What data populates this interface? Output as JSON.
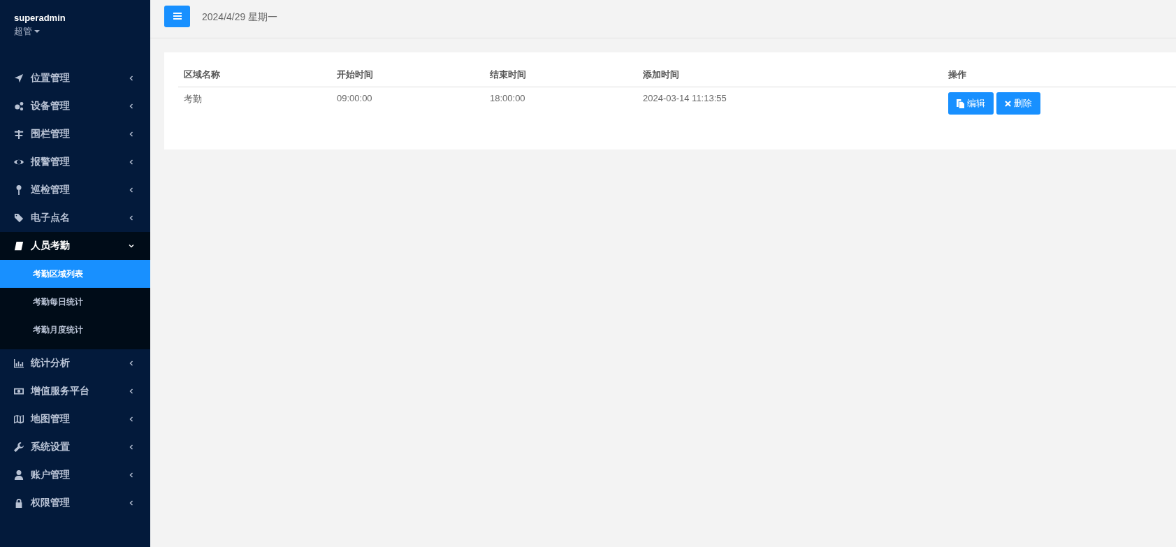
{
  "user": {
    "name": "superadmin",
    "role": "超管"
  },
  "menu": [
    {
      "label": "位置管理",
      "expanded": false
    },
    {
      "label": "设备管理",
      "expanded": false
    },
    {
      "label": "围栏管理",
      "expanded": false
    },
    {
      "label": "报警管理",
      "expanded": false
    },
    {
      "label": "巡检管理",
      "expanded": false
    },
    {
      "label": "电子点名",
      "expanded": false
    },
    {
      "label": "人员考勤",
      "expanded": true,
      "children": [
        {
          "label": "考勤区域列表",
          "selected": true
        },
        {
          "label": "考勤每日统计",
          "selected": false
        },
        {
          "label": "考勤月度统计",
          "selected": false
        }
      ]
    },
    {
      "label": "统计分析",
      "expanded": false
    },
    {
      "label": "增值服务平台",
      "expanded": false
    },
    {
      "label": "地图管理",
      "expanded": false
    },
    {
      "label": "系统设置",
      "expanded": false
    },
    {
      "label": "账户管理",
      "expanded": false
    },
    {
      "label": "权限管理",
      "expanded": false
    }
  ],
  "header": {
    "date": "2024/4/29 星期一"
  },
  "table": {
    "columns": [
      "区域名称",
      "开始时间",
      "结束时间",
      "添加时间",
      "操作"
    ],
    "rows": [
      {
        "cells": [
          "考勤",
          "09:00:00",
          "18:00:00",
          "2024-03-14 11:13:55"
        ],
        "actions": [
          {
            "label": "编辑",
            "kind": "edit"
          },
          {
            "label": "删除",
            "kind": "delete"
          }
        ]
      }
    ]
  }
}
